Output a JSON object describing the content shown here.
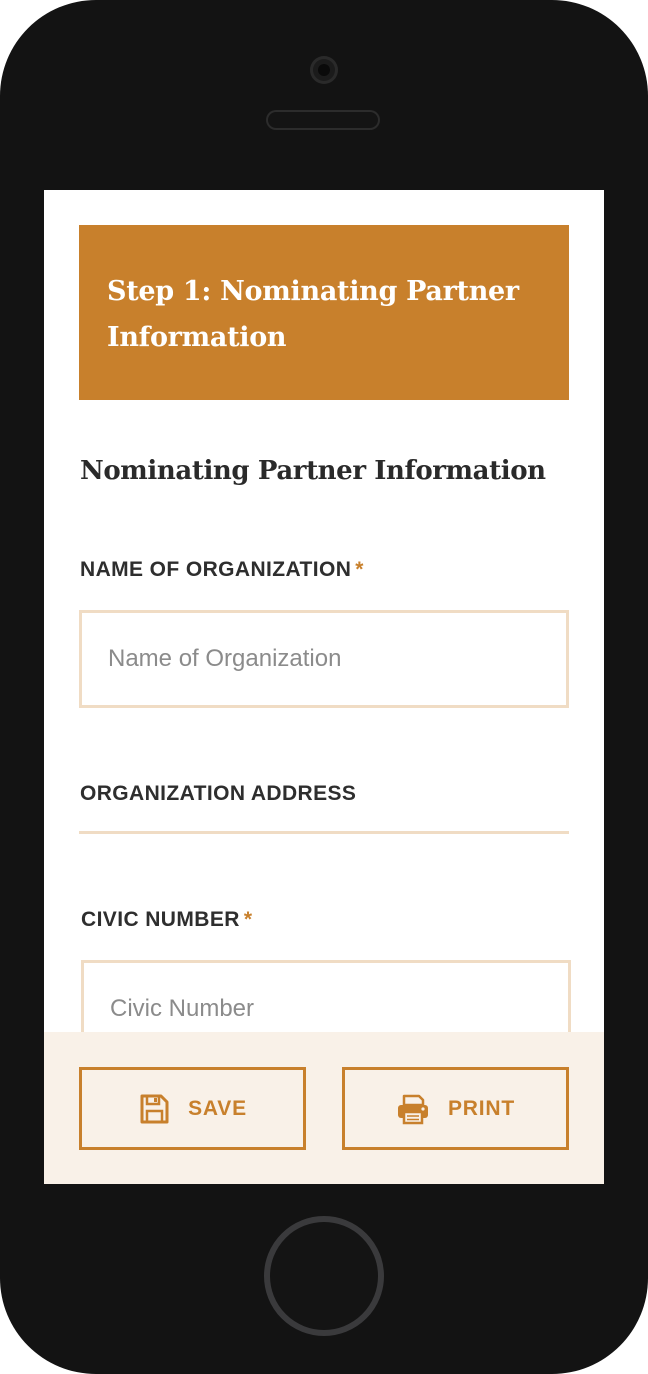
{
  "form": {
    "step_title": "Step 1: Nominating Partner Information",
    "section_heading": "Nominating Partner Information",
    "fields": {
      "organization_name": {
        "label": "NAME OF ORGANIZATION",
        "required_marker": "*",
        "value": "",
        "placeholder": "Name of Organization"
      },
      "organization_address": {
        "label": "ORGANIZATION ADDRESS"
      },
      "civic_number": {
        "label": "CIVIC NUMBER",
        "required_marker": "*",
        "value": "",
        "placeholder": "Civic Number"
      }
    }
  },
  "footer": {
    "save_label": "SAVE",
    "save_icon": "floppy-disk-icon",
    "print_label": "PRINT",
    "print_icon": "printer-icon"
  },
  "theme": {
    "accent": "#c8802c",
    "input_border": "#f0dcc4",
    "footer_background": "#f9f1e8",
    "device_body": "#131313"
  }
}
